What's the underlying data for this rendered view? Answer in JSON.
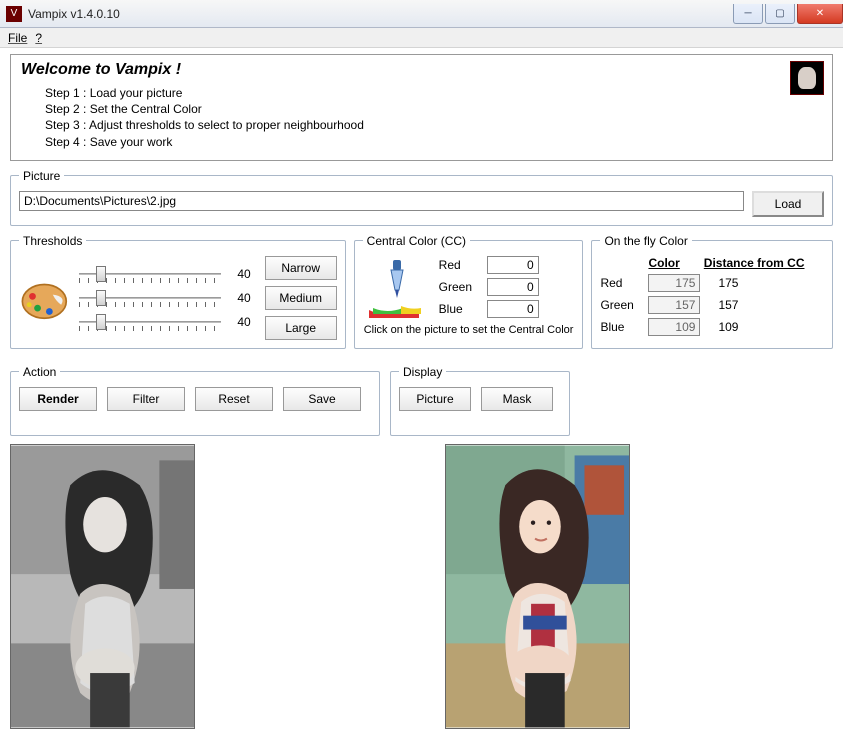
{
  "window": {
    "title": "Vampix v1.4.0.10"
  },
  "menu": {
    "file": "File",
    "help": "?"
  },
  "welcome": {
    "heading": "Welcome to Vampix !",
    "step1": "Step 1 : Load your picture",
    "step2": "Step 2 : Set the Central Color",
    "step3": "Step 3 : Adjust thresholds to select to proper neighbourhood",
    "step4": "Step 4 : Save your work"
  },
  "picture": {
    "legend": "Picture",
    "path": "D:\\Documents\\Pictures\\2.jpg",
    "load_label": "Load"
  },
  "thresholds": {
    "legend": "Thresholds",
    "v1": "40",
    "v2": "40",
    "v3": "40",
    "narrow_label": "Narrow",
    "medium_label": "Medium",
    "large_label": "Large"
  },
  "central_color": {
    "legend": "Central Color (CC)",
    "red_label": "Red",
    "green_label": "Green",
    "blue_label": "Blue",
    "red": "0",
    "green": "0",
    "blue": "0",
    "hint": "Click on the picture to set the Central Color"
  },
  "otf": {
    "legend": "On the fly Color",
    "col_color": "Color",
    "col_dist": "Distance from CC",
    "red_label": "Red",
    "green_label": "Green",
    "blue_label": "Blue",
    "red": "175",
    "green": "157",
    "blue": "109",
    "dist_r": "175",
    "dist_g": "157",
    "dist_b": "109"
  },
  "action": {
    "legend": "Action",
    "render": "Render",
    "filter": "Filter",
    "reset": "Reset",
    "save": "Save"
  },
  "display": {
    "legend": "Display",
    "picture": "Picture",
    "mask": "Mask"
  }
}
